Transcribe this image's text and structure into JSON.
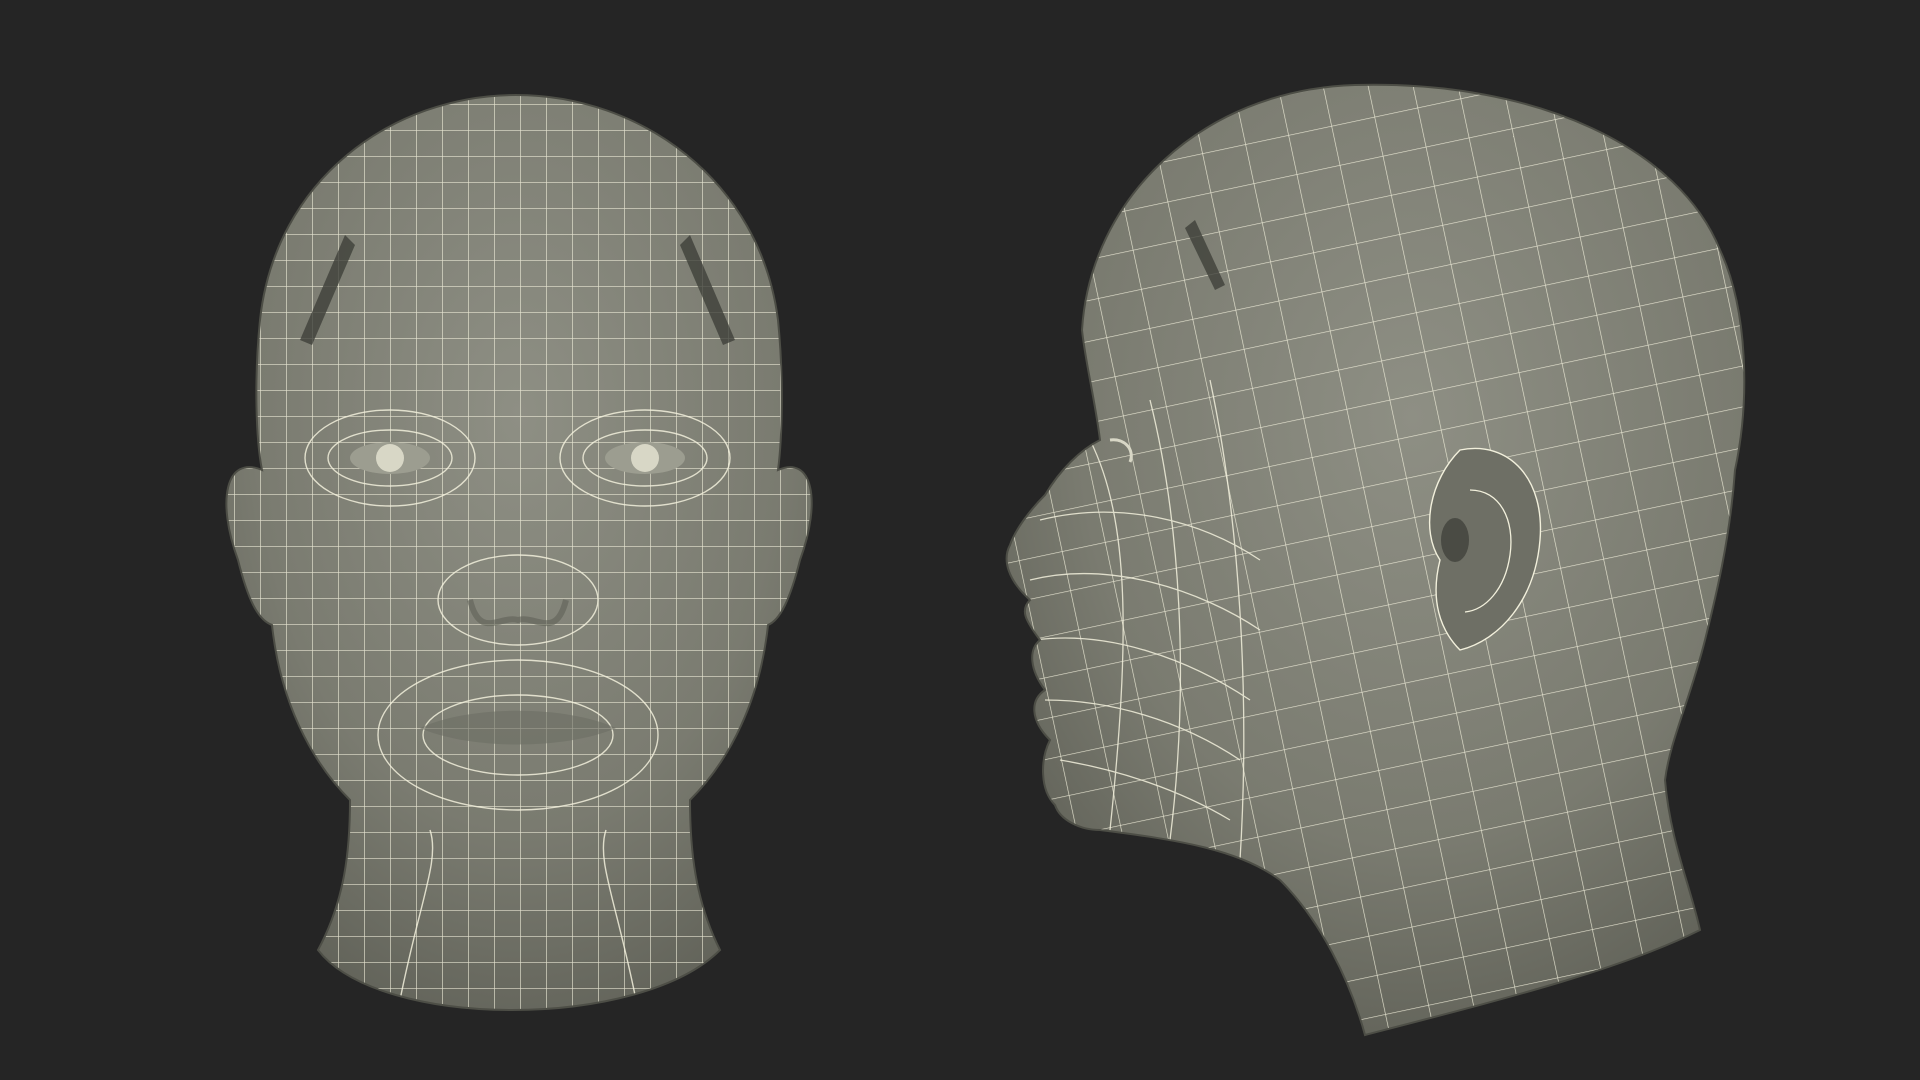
{
  "scene": {
    "background_color": "#252525",
    "mesh_surface_color": "#7c7d72",
    "wireframe_color": "#f2f0dc",
    "models": [
      {
        "view": "front",
        "subject": "head-model"
      },
      {
        "view": "side",
        "subject": "head-model"
      }
    ]
  }
}
